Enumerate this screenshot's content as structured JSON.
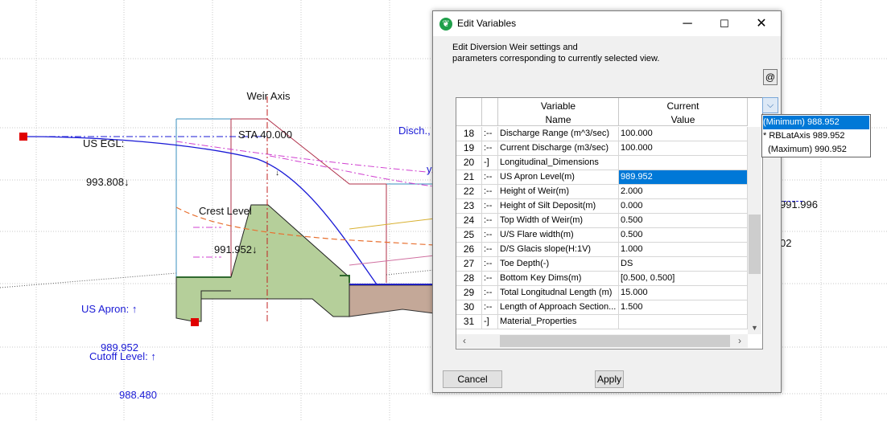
{
  "drawing": {
    "weir_axis": {
      "line1": "Weir Axis",
      "line2": "STA 40.000"
    },
    "us_egl": {
      "line1": "US EGL:",
      "line2": "993.808↓"
    },
    "crest_level": {
      "line1": "Crest Level",
      "line2": "991.952↓"
    },
    "us_apron": {
      "line1": "US Apron: ↑",
      "line2": "989.952"
    },
    "cutoff_level": {
      "line1": "Cutoff Level: ↑",
      "line2": "988.480"
    },
    "disch_partial": {
      "line1": "Disch.,",
      "line2": "y"
    },
    "right_partial": {
      "line1": "991.996",
      "line2": "02"
    }
  },
  "dialog": {
    "title": "Edit Variables",
    "description": "Edit Diversion Weir settings and\nparameters corresponding to currently selected view.",
    "at_button": "@",
    "grid": {
      "header": {
        "name": "Variable\nName",
        "value": "Current\nValue"
      },
      "rows": [
        {
          "num": "18",
          "tree": ":--",
          "name": "Discharge Range (m^3/sec)",
          "value": "100.000"
        },
        {
          "num": "19",
          "tree": ":--",
          "name": "Current Discharge (m3/sec)",
          "value": "100.000"
        },
        {
          "num": "20",
          "tree": "-]",
          "name": "Longitudinal_Dimensions",
          "value": ""
        },
        {
          "num": "21",
          "tree": ":--",
          "name": "US Apron Level(m)",
          "value": "989.952",
          "selected": true
        },
        {
          "num": "22",
          "tree": ":--",
          "name": "Height of Weir(m)",
          "value": "2.000"
        },
        {
          "num": "23",
          "tree": ":--",
          "name": "Height of Silt Deposit(m)",
          "value": "0.000"
        },
        {
          "num": "24",
          "tree": ":--",
          "name": "Top Width of Weir(m)",
          "value": "0.500"
        },
        {
          "num": "25",
          "tree": ":--",
          "name": "U/S Flare width(m)",
          "value": "0.500"
        },
        {
          "num": "26",
          "tree": ":--",
          "name": "D/S Glacis slope(H:1V)",
          "value": "1.000"
        },
        {
          "num": "27",
          "tree": ":--",
          "name": "Toe Depth(-)",
          "value": "DS"
        },
        {
          "num": "28",
          "tree": ":--",
          "name": "Bottom Key Dims(m)",
          "value": "[0.500, 0.500]"
        },
        {
          "num": "29",
          "tree": ":--",
          "name": "Total Longitudnal Length (m)",
          "value": "15.000"
        },
        {
          "num": "30",
          "tree": ":--",
          "name": "Length of Approach Section...",
          "value": "1.500"
        },
        {
          "num": "31",
          "tree": "-]",
          "name": "Material_Properties",
          "value": ""
        }
      ]
    },
    "cancel_label": "Cancel",
    "apply_label": "Apply"
  },
  "dropdown": {
    "options": [
      {
        "label": "(Minimum) 988.952",
        "selected": true
      },
      {
        "label": "* RBLatAxis 989.952",
        "selected": false
      },
      {
        "label": "  (Maximum) 990.952",
        "selected": false
      }
    ]
  },
  "colors": {
    "selection": "#0078d7",
    "weir_fill": "#b5cf9a",
    "downstream_fill": "#c4a898",
    "dim_text": "#1a1ad6"
  }
}
